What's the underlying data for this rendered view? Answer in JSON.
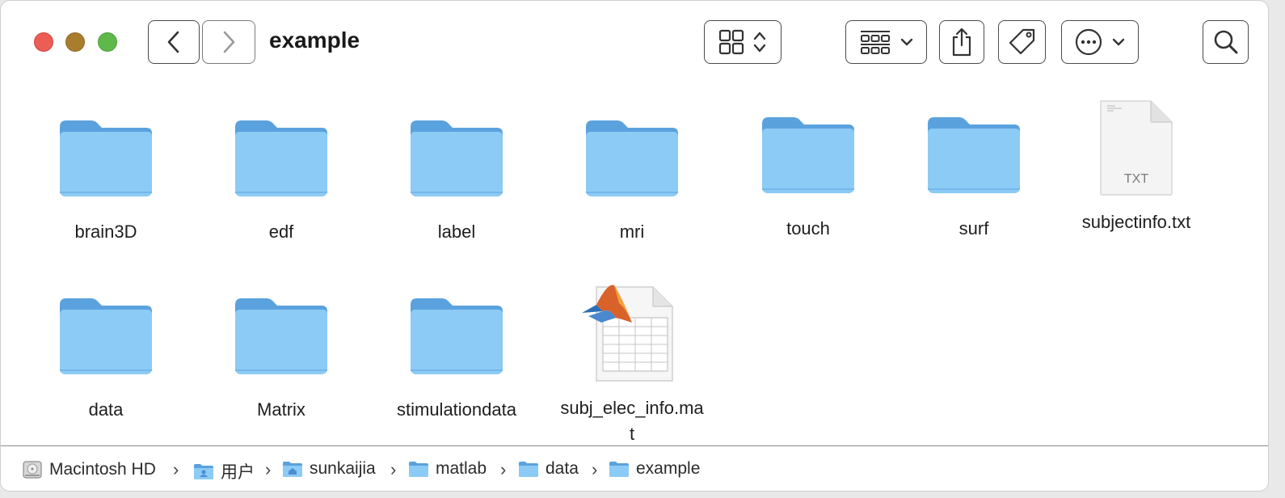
{
  "window": {
    "title": "example"
  },
  "toolbar": {
    "back_icon": "chevron-left-icon",
    "forward_icon": "chevron-right-icon",
    "view_icon": "grid-view-icon",
    "group_icon": "group-icon",
    "share_icon": "share-icon",
    "tag_icon": "tag-icon",
    "more_icon": "ellipsis-circle-icon",
    "search_icon": "search-icon"
  },
  "items": [
    {
      "name": "brain3D",
      "type": "folder"
    },
    {
      "name": "edf",
      "type": "folder"
    },
    {
      "name": "label",
      "type": "folder"
    },
    {
      "name": "mri",
      "type": "folder"
    },
    {
      "name": "touch",
      "type": "folder"
    },
    {
      "name": "surf",
      "type": "folder"
    },
    {
      "name": "subjectinfo.txt",
      "type": "txt",
      "icon_text": "TXT"
    },
    {
      "name": "data",
      "type": "folder"
    },
    {
      "name": "Matrix",
      "type": "folder"
    },
    {
      "name": "stimulationdata",
      "type": "folder"
    },
    {
      "name": "subj_elec_info.mat",
      "name_line1": "subj_elec_info.ma",
      "name_line2": "t",
      "type": "mat"
    }
  ],
  "pathbar": {
    "crumbs": [
      "Macintosh HD",
      "用户",
      "sunkaijia",
      "matlab",
      "data",
      "example"
    ],
    "separator": "›"
  },
  "colors": {
    "folder_front": "#8ccbf5",
    "folder_back": "#5aa2dd",
    "accent": "#3a7bd5"
  }
}
